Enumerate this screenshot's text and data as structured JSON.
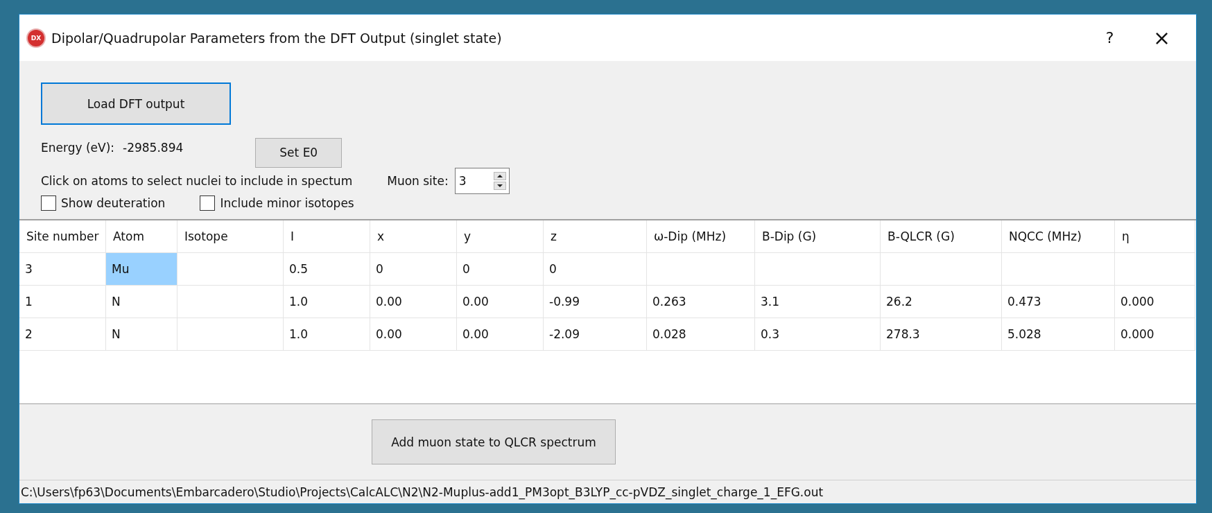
{
  "window": {
    "icon_label": "DX",
    "title": "Dipolar/Quadrupolar Parameters from the DFT Output (singlet state)",
    "help_button": "?",
    "close_button": "×"
  },
  "load_button": {
    "label": "Load DFT output",
    "focused": true
  },
  "energy": {
    "label": "Energy (eV):",
    "value": "-2985.894"
  },
  "set_e0_button": {
    "label": "Set E0"
  },
  "instruction": "Click on atoms to select nuclei to include in spectum",
  "muon_site": {
    "label": "Muon site:",
    "value": "3"
  },
  "checkboxes": [
    {
      "label": "Show deuteration",
      "checked": false
    },
    {
      "label": "Include minor isotopes",
      "checked": false
    }
  ],
  "table": {
    "columns": [
      "Site number",
      "Atom",
      "Isotope",
      "I",
      "x",
      "y",
      "z",
      "ω-Dip (MHz)",
      "B-Dip (G)",
      "B-QLCR (G)",
      "NQCC (MHz)",
      "η"
    ],
    "rows": [
      {
        "cells": [
          {
            "text": "3",
            "selected": false
          },
          {
            "text": "Mu",
            "selected": true
          },
          {
            "selected": false
          },
          {
            "text": "0.5",
            "selected": false
          },
          {
            "text": "0",
            "selected": false
          },
          {
            "text": "0",
            "selected": false
          },
          {
            "text": "0",
            "selected": false
          },
          {
            "selected": false
          },
          {
            "selected": false
          },
          {
            "selected": false
          },
          {
            "selected": false
          },
          {
            "selected": false
          }
        ]
      },
      {
        "cells": [
          {
            "text": "1",
            "selected": false
          },
          {
            "text": "N",
            "selected": false
          },
          {
            "selected": false
          },
          {
            "text": "1.0",
            "selected": false
          },
          {
            "text": "0.00",
            "selected": false
          },
          {
            "text": "0.00",
            "selected": false
          },
          {
            "text": "-0.99",
            "selected": false
          },
          {
            "text": "0.263",
            "selected": false
          },
          {
            "text": "3.1",
            "selected": false
          },
          {
            "text": "26.2",
            "selected": false
          },
          {
            "text": "0.473",
            "selected": false
          },
          {
            "text": "0.000",
            "selected": false
          }
        ]
      },
      {
        "cells": [
          {
            "text": "2",
            "selected": false
          },
          {
            "text": "N",
            "selected": false
          },
          {
            "selected": false
          },
          {
            "text": "1.0",
            "selected": false
          },
          {
            "text": "0.00",
            "selected": false
          },
          {
            "text": "0.00",
            "selected": false
          },
          {
            "text": "-2.09",
            "selected": false
          },
          {
            "text": "0.028",
            "selected": false
          },
          {
            "text": "0.3",
            "selected": false
          },
          {
            "text": "278.3",
            "selected": false
          },
          {
            "text": "5.028",
            "selected": false
          },
          {
            "text": "0.000",
            "selected": false
          }
        ]
      }
    ]
  },
  "add_button": {
    "label": "Add muon state to QLCR spectrum"
  },
  "status_bar": "C:\\Users\\fp63\\Documents\\Embarcadero\\Studio\\Projects\\CalcALC\\N2\\N2-Muplus-add1_PM3opt_B3LYP_cc-pVDZ_singlet_charge_1_EFG.out"
}
